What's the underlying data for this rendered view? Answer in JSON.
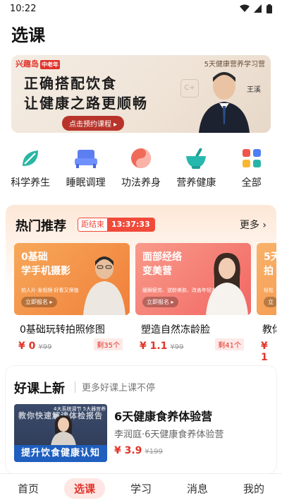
{
  "status_bar": {
    "time": "10:22"
  },
  "page_title": "选课",
  "banner": {
    "brand": "兴趣岛",
    "brand_tag": "中老年",
    "camp": "5天健康营养学习营",
    "headline1": "正确搭配饮食",
    "headline2": "让健康之路更顺畅",
    "cta": "点击预约课程 ▸",
    "teacher": "王溪",
    "deco": "C+"
  },
  "categories": [
    {
      "label": "科学养生",
      "icon": "leaf-icon"
    },
    {
      "label": "睡眠调理",
      "icon": "bed-icon"
    },
    {
      "label": "功法养身",
      "icon": "yin-yang-icon"
    },
    {
      "label": "营养健康",
      "icon": "mortar-icon"
    },
    {
      "label": "全部",
      "icon": "grid-icon"
    }
  ],
  "hot": {
    "title": "热门推荐",
    "countdown_label": "距结束",
    "countdown_time": "13:37:33",
    "more": "更多 ›",
    "cards": [
      {
        "thumb_line1": "0基础",
        "thumb_line2": "学手机摄影",
        "thumb_sub": "拍人片·发视频·好看又保值",
        "thumb_cta": "立即报名 ▸",
        "name": "0基础玩转拍照修图",
        "price": "¥ 0",
        "old_price": "¥99",
        "left": "剩35个",
        "color": "#f39a4e"
      },
      {
        "thumb_line1": "面部经络",
        "thumb_line2": "变美营",
        "thumb_sub": "缓解疲劳、逆龄美肤、改善年轻态",
        "thumb_cta": "立即报名 ▸",
        "name": "塑造自然冻龄脸",
        "price": "¥ 1.1",
        "old_price": "¥99",
        "left": "剩41个",
        "color": "#f47b7b"
      },
      {
        "thumb_line1": "5天",
        "thumb_line2": "拍",
        "thumb_sub": "轻松",
        "thumb_cta": "立",
        "name": "教你",
        "price": "¥ 1",
        "old_price": "",
        "left": "",
        "color": "#f7a254"
      }
    ]
  },
  "new_courses": {
    "title": "好课上新",
    "subtitle": "更多好课上课不停",
    "course": {
      "thumb_top": "4大系统调节 5大器官养护",
      "thumb_watermark": "教你快速解读体检报告",
      "thumb_banner": "提升饮食健康认知",
      "title": "6天健康食养体验营",
      "desc": "李润庭·6天健康食养体验营",
      "price": "¥ 3.9",
      "old_price": "¥199"
    }
  },
  "tabbar": [
    {
      "label": "首页",
      "active": false
    },
    {
      "label": "选课",
      "active": true
    },
    {
      "label": "学习",
      "active": false
    },
    {
      "label": "消息",
      "active": false
    },
    {
      "label": "我的",
      "active": false
    }
  ],
  "colors": {
    "accent": "#e2342a",
    "tab_active_bg": "#fde6e3"
  }
}
